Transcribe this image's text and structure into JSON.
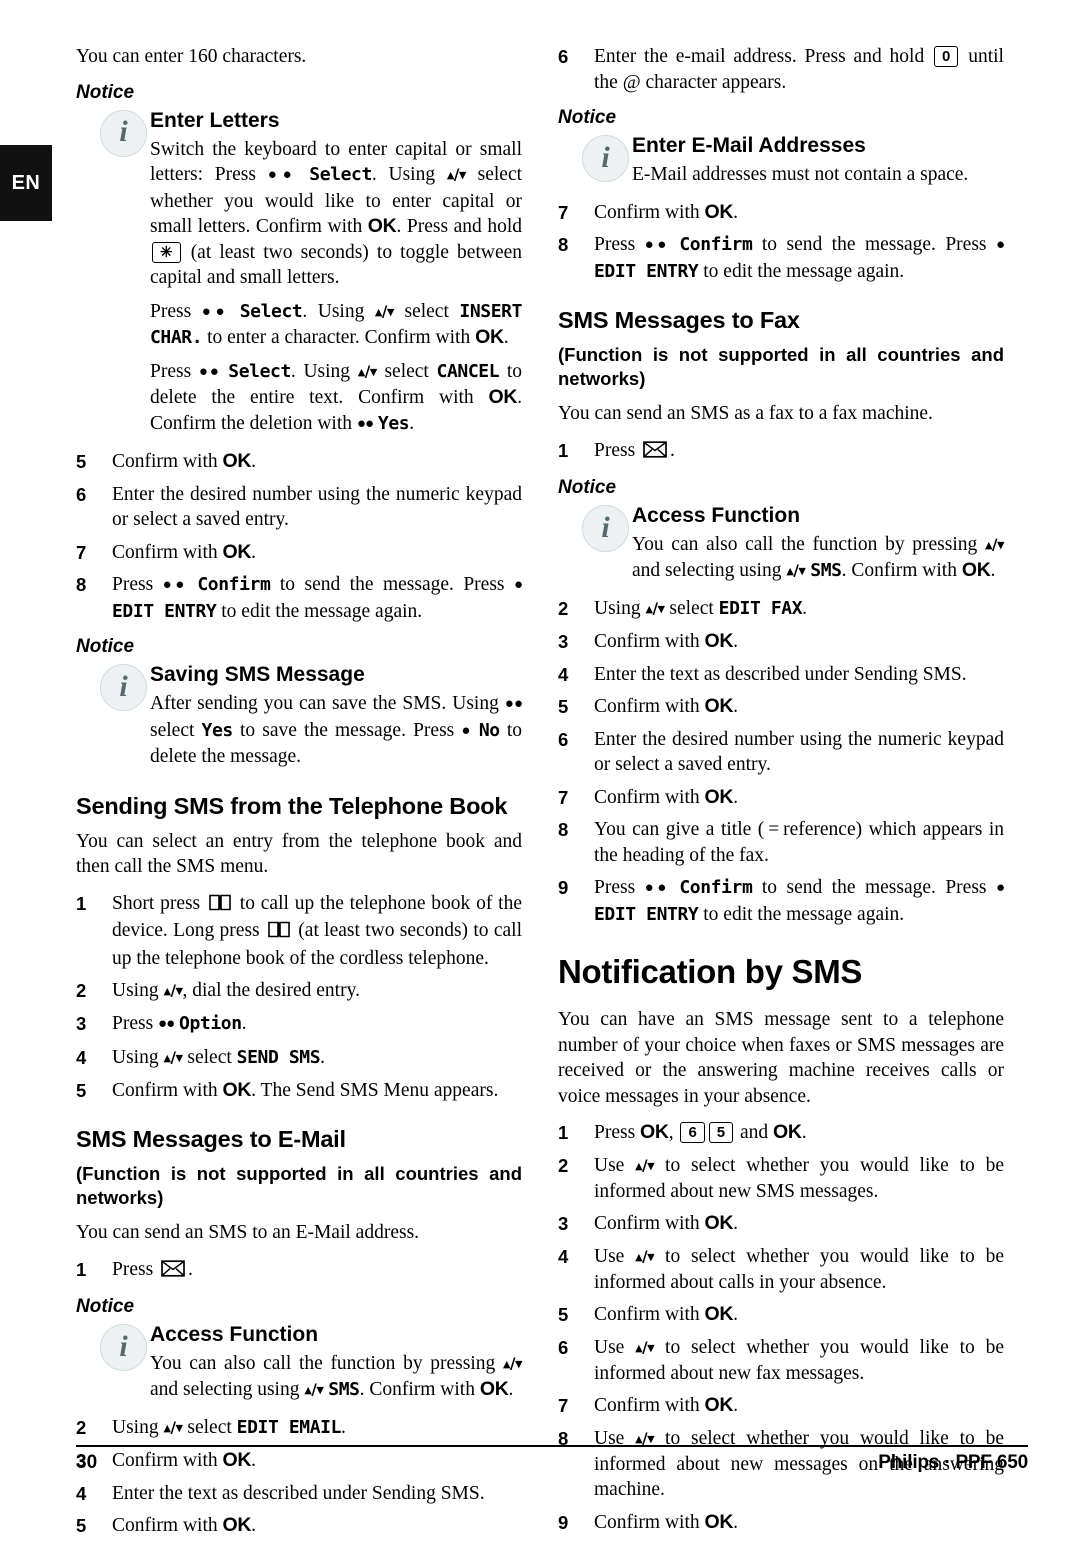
{
  "language_tab": "EN",
  "footer": {
    "page_number": "30",
    "brand": "Philips · PPF 650"
  },
  "left_column": {
    "intro": "You can enter 160 characters.",
    "notice_label_1": "Notice",
    "notice_enter_letters": {
      "title": "Enter Letters",
      "para1_a": "Switch the keyboard to enter capital or small letters: Press ",
      "para1_dots": "●●",
      "para1_lcd1": "Select",
      "para1_b": ". Using ",
      "para1_arrows": "▴/▾",
      "para1_c": " select whether you would like to enter capital or small letters. Confirm with ",
      "para1_ok": "OK",
      "para1_d": ". Press and hold ",
      "para1_key": "✳",
      "para1_e": " (at least two seconds) to toggle between capital and small letters.",
      "para2_a": "Press ",
      "para2_dots": "●●",
      "para2_lcd1": "Select",
      "para2_b": ". Using ",
      "para2_arrows": "▴/▾",
      "para2_c": " select ",
      "para2_lcd2": "INSERT CHAR.",
      "para2_d": " to enter a character. Confirm with ",
      "para2_ok": "OK",
      "para2_e": ".",
      "para3_a": "Press ",
      "para3_dots": "●●",
      "para3_lcd1": "Select",
      "para3_b": ". Using ",
      "para3_arrows": "▴/▾",
      "para3_c": " select ",
      "para3_lcd2": "CANCEL",
      "para3_d": " to delete the entire text. Confirm with ",
      "para3_ok": "OK",
      "para3_e": ". Confirm the deletion with ",
      "para3_dots2": "●●",
      "para3_lcd3": "Yes",
      "para3_f": "."
    },
    "steps_sending": [
      {
        "num": "5",
        "a": "Confirm with ",
        "ok": "OK",
        "b": "."
      },
      {
        "num": "6",
        "a": "Enter the desired number using the numeric keypad or select a saved entry.",
        "ok": "",
        "b": ""
      },
      {
        "num": "7",
        "a": "Confirm with ",
        "ok": "OK",
        "b": "."
      },
      {
        "num": "8",
        "a": "Press ",
        "ok": "",
        "b": ""
      }
    ],
    "step8_dots": "●●",
    "step8_lcd1": "Confirm",
    "step8_mid": " to send the message. Press ",
    "step8_dot": "●",
    "step8_lcd2": "EDIT ENTRY",
    "step8_end": " to edit the message again.",
    "notice_label_2": "Notice",
    "notice_saving": {
      "title": "Saving SMS Message",
      "a": "After sending you can save the SMS. Using ",
      "dots": "●●",
      "b": " select ",
      "lcd1": "Yes",
      "c": " to save the message. Press ",
      "dot": "●",
      "lcd2": "No",
      "d": " to delete the message."
    },
    "heading_telbook": "Sending SMS from the Telephone Book",
    "telbook_intro": "You can select an entry from the telephone book and then call the SMS menu.",
    "telbook_steps": {
      "s1_a": "Short press ",
      "s1_b": " to call up the telephone book of the device. Long press ",
      "s1_c": " (at least two seconds) to call up the telephone book of the cordless telephone.",
      "s2_a": "Using ",
      "s2_arrows": "▴/▾",
      "s2_b": ", dial the desired entry.",
      "s3_a": "Press ",
      "s3_dots": "●●",
      "s3_lcd": "Option",
      "s3_b": ".",
      "s4_a": "Using ",
      "s4_arrows": "▴/▾",
      "s4_b": " select ",
      "s4_lcd": "SEND SMS",
      "s4_c": ".",
      "s5_a": "Confirm with ",
      "s5_ok": "OK",
      "s5_b": ". The Send SMS Menu appears."
    },
    "heading_email": "SMS Messages to E-Mail",
    "email_subnote": "(Function is not supported in all countries and networks)",
    "email_intro": "You can send an SMS to an E-Mail address.",
    "email_step1": "Press ",
    "email_step1_end": ".",
    "notice_label_3": "Notice",
    "notice_access_1": {
      "title": "Access Function",
      "a": "You can also call the function by pressing ",
      "arrows1": "▴/▾",
      "b": " and selecting using ",
      "arrows2": "▴/▾",
      "lcd": "SMS",
      "c": ". Confirm with ",
      "ok": "OK",
      "d": "."
    },
    "email_steps": {
      "s2_a": "Using ",
      "s2_arrows": "▴/▾",
      "s2_b": " select ",
      "s2_lcd": "EDIT EMAIL",
      "s2_c": ".",
      "s3_a": "Confirm with ",
      "s3_ok": "OK",
      "s3_b": ".",
      "s4_a": "Enter the text as described under Sending SMS.",
      "s5_a": "Confirm with ",
      "s5_ok": "OK",
      "s5_b": "."
    }
  },
  "right_column": {
    "step6": {
      "num": "6",
      "a": "Enter the e-mail address. Press and hold ",
      "key": "0",
      "b": " until the @ character appears."
    },
    "notice_label_1": "Notice",
    "notice_email_addresses": {
      "title": "Enter E-Mail Addresses",
      "body": "E-Mail addresses must not contain a space."
    },
    "step7": {
      "num": "7",
      "a": "Confirm with ",
      "ok": "OK",
      "b": "."
    },
    "step8": {
      "num": "8",
      "a": "Press ",
      "dots": "●●",
      "lcd1": "Confirm",
      "b": " to send the message. Press ",
      "dot": "●",
      "lcd2": "EDIT ENTRY",
      "c": " to edit the message again."
    },
    "heading_fax": "SMS Messages to Fax",
    "fax_subnote": "(Function is not supported in all countries and networks)",
    "fax_intro": "You can send an SMS as a fax to a fax machine.",
    "fax_step1": "Press ",
    "fax_step1_end": ".",
    "notice_label_2": "Notice",
    "notice_access_2": {
      "title": "Access Function",
      "a": "You can also call the function by pressing ",
      "arrows1": "▴/▾",
      "b": " and selecting using ",
      "arrows2": "▴/▾",
      "lcd": "SMS",
      "c": ". Confirm with ",
      "ok": "OK",
      "d": "."
    },
    "fax_steps": {
      "s2_a": "Using ",
      "s2_arrows": "▴/▾",
      "s2_b": " select ",
      "s2_lcd": "EDIT FAX",
      "s2_c": ".",
      "s3_a": "Confirm with ",
      "s3_ok": "OK",
      "s3_b": ".",
      "s4_a": "Enter the text as described under Sending SMS.",
      "s5_a": "Confirm with ",
      "s5_ok": "OK",
      "s5_b": ".",
      "s6_a": "Enter the desired number using the numeric keypad or select a saved entry.",
      "s7_a": "Confirm with ",
      "s7_ok": "OK",
      "s7_b": ".",
      "s8_a": "You can give a title ( = reference) which appears in the heading of the fax.",
      "s9_a": "Press ",
      "s9_dots": "●●",
      "s9_lcd1": "Confirm",
      "s9_b": " to send the message. Press ",
      "s9_dot": "●",
      "s9_lcd2": "EDIT ENTRY",
      "s9_c": " to edit the message again."
    },
    "heading_notification": "Notification by SMS",
    "notification_intro": "You can have an SMS message sent to a telephone number of your choice when faxes or SMS messages are received or the answering machine receives calls or voice messages in your absence.",
    "notification_steps": {
      "s1_a": "Press ",
      "s1_ok1": "OK",
      "s1_b": ", ",
      "s1_key1": "6",
      "s1_key2": "5",
      "s1_c": " and ",
      "s1_ok2": "OK",
      "s1_d": ".",
      "s2_a": "Use ",
      "s2_arrows": "▴/▾",
      "s2_b": " to select whether you would like to be informed about new SMS messages.",
      "s3_a": "Confirm with ",
      "s3_ok": "OK",
      "s3_b": ".",
      "s4_a": "Use ",
      "s4_arrows": "▴/▾",
      "s4_b": " to select whether you would like to be informed about calls in your absence.",
      "s5_a": "Confirm with ",
      "s5_ok": "OK",
      "s5_b": ".",
      "s6_a": "Use ",
      "s6_arrows": "▴/▾",
      "s6_b": " to select whether you would like to be informed about new fax messages.",
      "s7_a": "Confirm with ",
      "s7_ok": "OK",
      "s7_b": ".",
      "s8_a": "Use ",
      "s8_arrows": "▴/▾",
      "s8_b": " to select whether you would like to be informed about new messages on the answering machine.",
      "s9_a": "Confirm with ",
      "s9_ok": "OK",
      "s9_b": "."
    }
  },
  "step_numbers": {
    "n1": "1",
    "n2": "2",
    "n3": "3",
    "n4": "4",
    "n5": "5",
    "n6": "6",
    "n7": "7",
    "n8": "8",
    "n9": "9"
  }
}
